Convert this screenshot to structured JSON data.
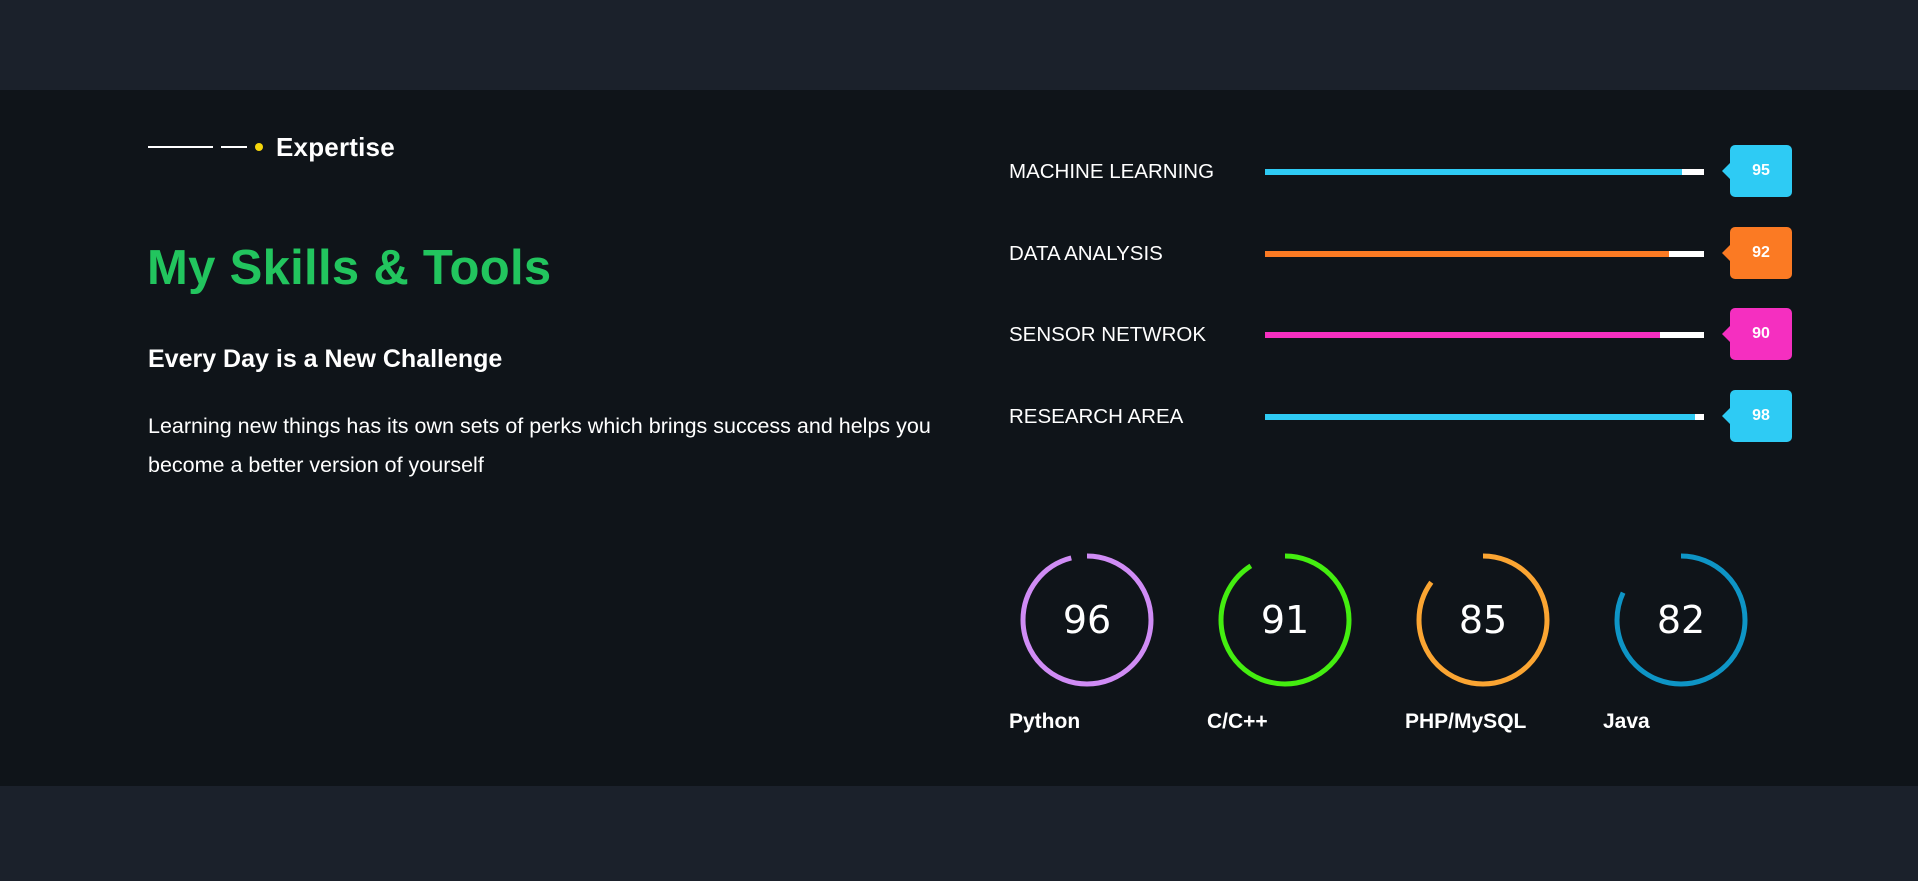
{
  "section": {
    "eyebrow": "Expertise",
    "title": "My Skills & Tools",
    "subtitle": "Every Day is a New Challenge",
    "description": "Learning new things has its own sets of perks which brings success and helps you become a better version of yourself"
  },
  "colors": {
    "background": "#0f1419",
    "outer_background": "#1b212b",
    "title": "#22c55e",
    "eyebrow_dot": "#f5d60b",
    "track": "#ffffff"
  },
  "skills_bars": [
    {
      "label": "MACHINE LEARNING",
      "value": 95,
      "badge": "95",
      "color": "#2ecbf4"
    },
    {
      "label": "DATA ANALYSIS",
      "value": 92,
      "badge": "92",
      "color": "#fb7a23"
    },
    {
      "label": "SENSOR NETWROK",
      "value": 90,
      "badge": "90",
      "color": "#f52fc0"
    },
    {
      "label": "RESEARCH AREA",
      "value": 98,
      "badge": "98",
      "color": "#2ecbf4"
    }
  ],
  "tools_circles": [
    {
      "label": "Python",
      "value": 96,
      "display": "96",
      "color": "#d08cf5"
    },
    {
      "label": "C/C++",
      "value": 91,
      "display": "91",
      "color": "#44ee10"
    },
    {
      "label": "PHP/MySQL",
      "value": 85,
      "display": "85",
      "color": "#fba532"
    },
    {
      "label": "Java",
      "value": 82,
      "display": "82",
      "color": "#0e95c6"
    }
  ]
}
